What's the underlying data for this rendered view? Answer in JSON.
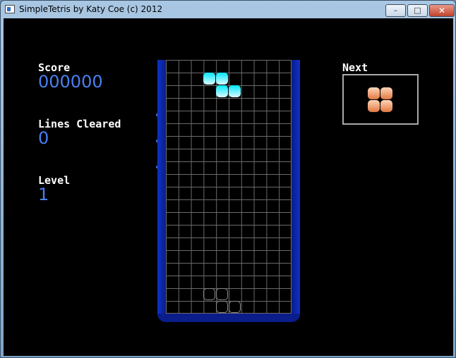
{
  "window": {
    "title": "SimpleTetris by Katy Coe (c) 2012",
    "controls": {
      "minimize": "–",
      "maximize": "□",
      "close": "✕"
    }
  },
  "stats": {
    "score_label": "Score",
    "score_value": "000000",
    "lines_label": "Lines Cleared",
    "lines_value": "0",
    "level_label": "Level",
    "level_value": "1"
  },
  "next": {
    "label": "Next",
    "piece": "O",
    "piece_color": "#f0a070"
  },
  "board": {
    "columns": 10,
    "rows": 20,
    "active_piece": "Z",
    "active_piece_color": "#00f0ff",
    "ghost_piece": "Z",
    "well_color": "#0a1d8a",
    "grid_color": "#6b6b6b"
  }
}
